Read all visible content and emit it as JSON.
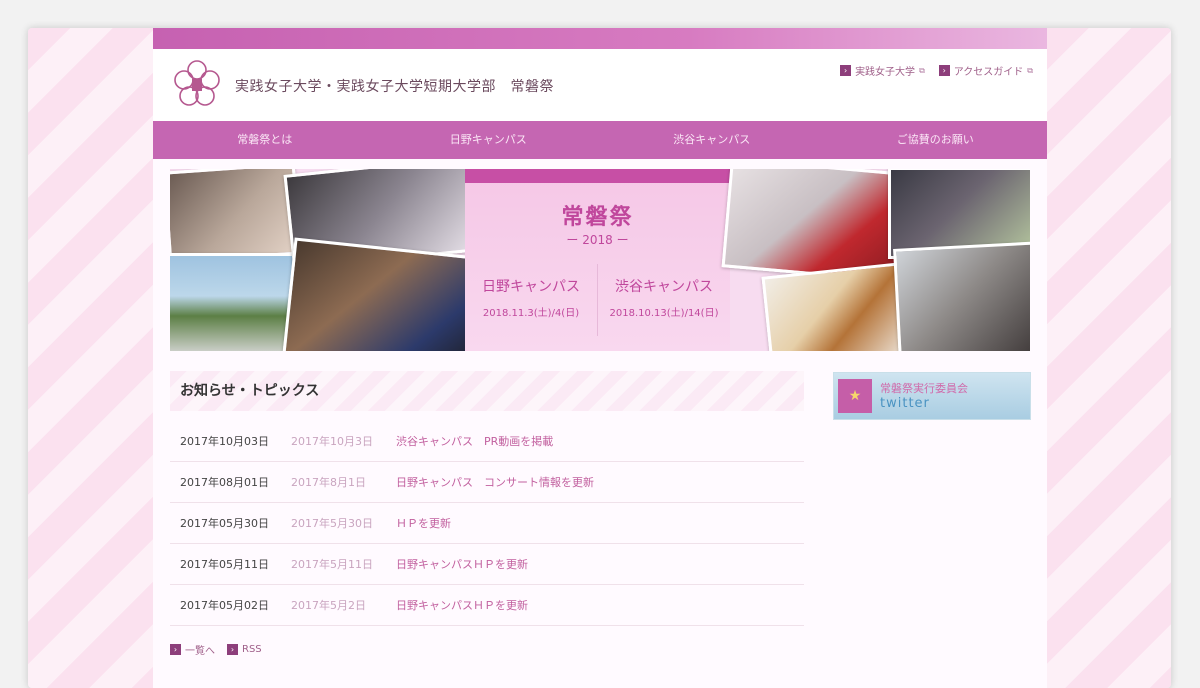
{
  "site": {
    "title": "実践女子大学・実践女子大学短期大学部　常磐祭",
    "util_links": [
      {
        "label": "実践女子大学"
      },
      {
        "label": "アクセスガイド"
      }
    ]
  },
  "nav": [
    {
      "label": "常磐祭とは"
    },
    {
      "label": "日野キャンパス"
    },
    {
      "label": "渋谷キャンパス"
    },
    {
      "label": "ご協賛のお願い"
    }
  ],
  "hero": {
    "title": "常磐祭",
    "year": "ー 2018 ー",
    "campuses": [
      {
        "name": "日野キャンパス",
        "date": "2018.11.3(土)/4(日)"
      },
      {
        "name": "渋谷キャンパス",
        "date": "2018.10.13(土)/14(日)"
      }
    ]
  },
  "news": {
    "heading": "お知らせ・トピックス",
    "items": [
      {
        "date": "2017年10月03日",
        "sub": "2017年10月3日",
        "title": "渋谷キャンパス　PR動画を掲載"
      },
      {
        "date": "2017年08月01日",
        "sub": "2017年8月1日",
        "title": "日野キャンパス　コンサート情報を更新"
      },
      {
        "date": "2017年05月30日",
        "sub": "2017年5月30日",
        "title": "ＨＰを更新"
      },
      {
        "date": "2017年05月11日",
        "sub": "2017年5月11日",
        "title": "日野キャンパスＨＰを更新"
      },
      {
        "date": "2017年05月02日",
        "sub": "2017年5月2日",
        "title": "日野キャンパスＨＰを更新"
      }
    ],
    "footer_links": [
      {
        "label": "一覧へ"
      },
      {
        "label": "RSS"
      }
    ]
  },
  "sidebar": {
    "twitter_line1": "常磐祭実行委員会",
    "twitter_line2": "twitter"
  },
  "colors": {
    "accent": "#c566b2",
    "link": "#c2609f"
  }
}
